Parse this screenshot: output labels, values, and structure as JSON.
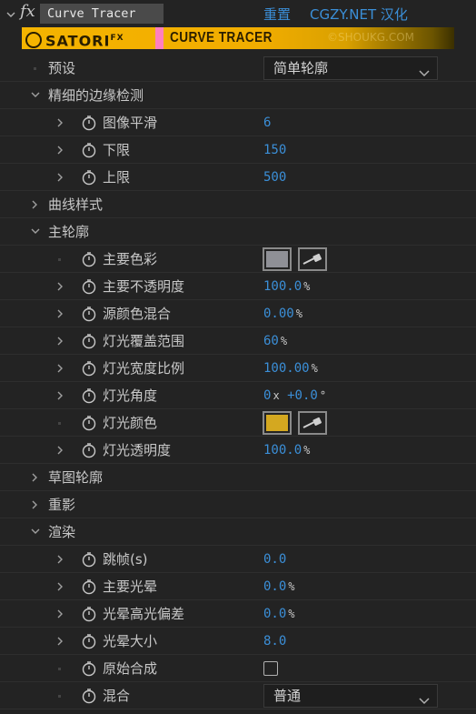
{
  "header": {
    "fx_symbol": "fx",
    "effect_name": "Curve Tracer",
    "reset_label": "重置",
    "credit_label": "CGZY.NET 汉化"
  },
  "banner": {
    "brand": "SATORI",
    "brand_sup": "FX",
    "product": "CURVE TRACER",
    "watermark": "©SHOUKG.COM"
  },
  "colors": {
    "accent_blue": "#3b8fd8",
    "main_color": "#8f9096",
    "light_color": "#d4a820",
    "banner_gold": "#f5b400",
    "pink_stripe": "#ff7fbf"
  },
  "rows": {
    "preset": {
      "label": "预设",
      "value": "简单轮廓"
    },
    "fine_edge": {
      "label": "精细的边缘检测"
    },
    "image_smooth": {
      "label": "图像平滑",
      "value": "6"
    },
    "lower_limit": {
      "label": "下限",
      "value": "150"
    },
    "upper_limit": {
      "label": "上限",
      "value": "500"
    },
    "curve_style": {
      "label": "曲线样式"
    },
    "main_outline": {
      "label": "主轮廓"
    },
    "main_color": {
      "label": "主要色彩"
    },
    "main_opacity": {
      "label": "主要不透明度",
      "value": "100.0",
      "unit": "%"
    },
    "source_blend": {
      "label": "源颜色混合",
      "value": "0.00",
      "unit": "%"
    },
    "light_coverage": {
      "label": "灯光覆盖范围",
      "value": "60",
      "unit": "%"
    },
    "light_width": {
      "label": "灯光宽度比例",
      "value": "100.00",
      "unit": "%"
    },
    "light_angle": {
      "label": "灯光角度",
      "value_turns": "0",
      "turns_unit": "x",
      "value_deg": "+0.0",
      "deg_unit": "°"
    },
    "light_color": {
      "label": "灯光颜色"
    },
    "light_opacity": {
      "label": "灯光透明度",
      "value": "100.0",
      "unit": "%"
    },
    "sketch_outline": {
      "label": "草图轮廓"
    },
    "shadow": {
      "label": "重影"
    },
    "render": {
      "label": "渲染"
    },
    "skip_frames": {
      "label": "跳帧(s)",
      "value": "0.0"
    },
    "main_glow": {
      "label": "主要光晕",
      "value": "0.0",
      "unit": "%"
    },
    "glow_highlight": {
      "label": "光晕高光偏差",
      "value": "0.0",
      "unit": "%"
    },
    "glow_size": {
      "label": "光晕大小",
      "value": "8.0"
    },
    "original_comp": {
      "label": "原始合成",
      "checked": false
    },
    "blend": {
      "label": "混合",
      "value": "普通"
    }
  }
}
